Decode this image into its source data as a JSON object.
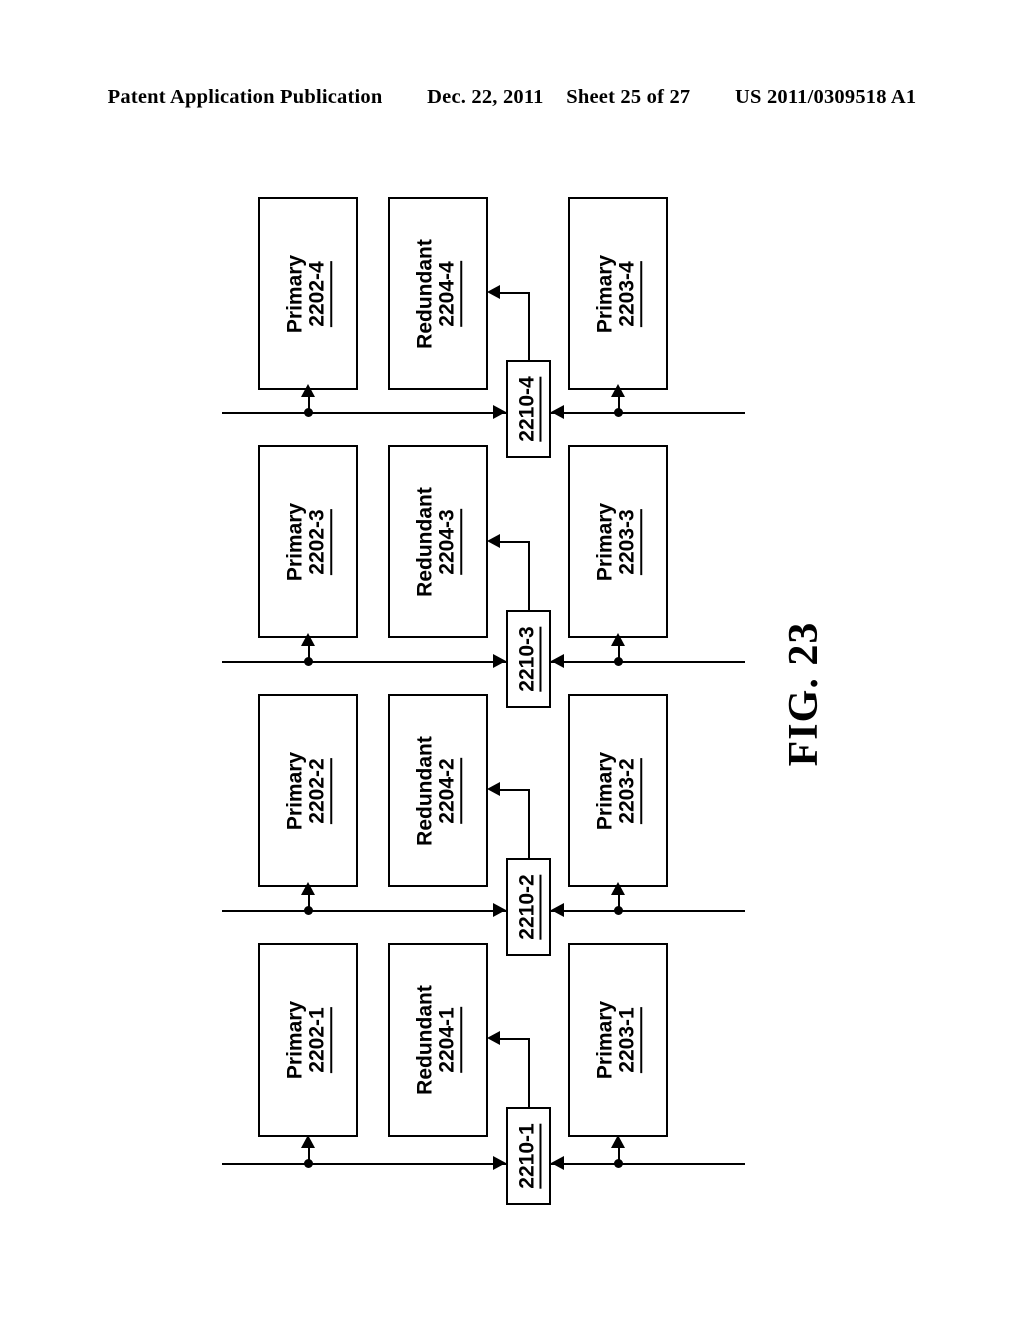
{
  "header": {
    "publication": "Patent Application Publication",
    "date": "Dec. 22, 2011",
    "sheet": "Sheet 25 of 27",
    "pub_number": "US 2011/0309518 A1"
  },
  "figure": {
    "caption": "FIG. 23",
    "orientation": "rotated-90",
    "groups": [
      {
        "id": "group-4",
        "primary_left": {
          "name": "Primary",
          "number": "2202-4"
        },
        "redundant": {
          "name": "Redundant",
          "number": "2204-4"
        },
        "primary_right": {
          "name": "Primary",
          "number": "2203-4"
        },
        "switch": {
          "number": "2210-4"
        }
      },
      {
        "id": "group-3",
        "primary_left": {
          "name": "Primary",
          "number": "2202-3"
        },
        "redundant": {
          "name": "Redundant",
          "number": "2204-3"
        },
        "primary_right": {
          "name": "Primary",
          "number": "2203-3"
        },
        "switch": {
          "number": "2210-3"
        }
      },
      {
        "id": "group-2",
        "primary_left": {
          "name": "Primary",
          "number": "2202-2"
        },
        "redundant": {
          "name": "Redundant",
          "number": "2204-2"
        },
        "primary_right": {
          "name": "Primary",
          "number": "2203-2"
        },
        "switch": {
          "number": "2210-2"
        }
      },
      {
        "id": "group-1",
        "primary_left": {
          "name": "Primary",
          "number": "2202-1"
        },
        "redundant": {
          "name": "Redundant",
          "number": "2204-1"
        },
        "primary_right": {
          "name": "Primary",
          "number": "2203-1"
        },
        "switch": {
          "number": "2210-1"
        }
      }
    ]
  },
  "colors": {
    "ink": "#000000",
    "paper": "#ffffff"
  }
}
